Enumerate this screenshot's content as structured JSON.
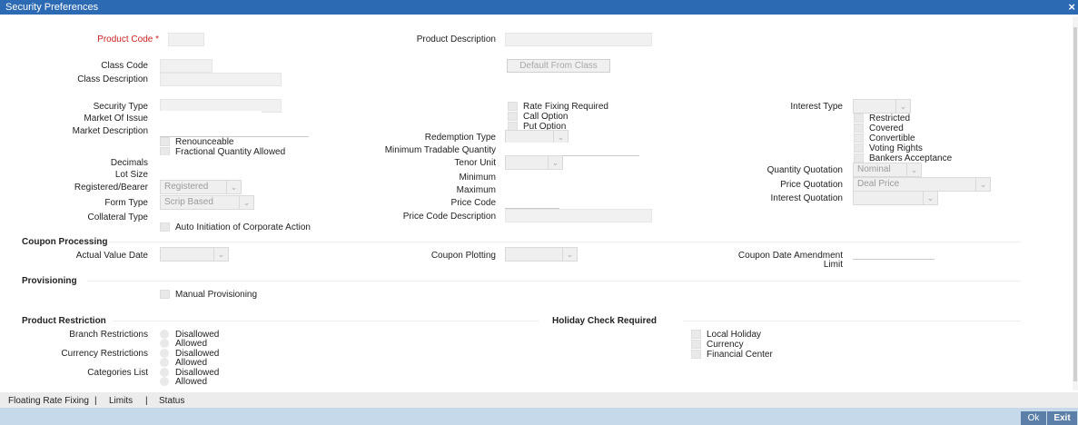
{
  "window": {
    "title": "Security Preferences",
    "close_glyph": "×"
  },
  "fields": {
    "product_code": "Product Code *",
    "product_description": "Product Description",
    "class_code": "Class Code",
    "class_description": "Class Description",
    "default_from_class": "Default From Class",
    "security_type": "Security Type",
    "market_of_issue": "Market Of Issue",
    "market_description": "Market Description",
    "renounceable": "Renounceable",
    "fractional_qty": "Fractional Quantity Allowed",
    "decimals": "Decimals",
    "lot_size": "Lot Size",
    "registered_bearer": "Registered/Bearer",
    "registered_value": "Registered",
    "form_type": "Form Type",
    "form_type_value": "Scrip Based",
    "collateral_type": "Collateral Type",
    "auto_initiation": "Auto Initiation of Corporate Action",
    "rate_fixing": "Rate Fixing Required",
    "call_option": "Call Option",
    "put_option": "Put Option",
    "redemption_type": "Redemption Type",
    "min_tradable_qty": "Minimum Tradable Quantity",
    "tenor_unit": "Tenor Unit",
    "minimum": "Minimum",
    "maximum": "Maximum",
    "price_code": "Price Code",
    "price_code_description": "Price Code Description",
    "interest_type": "Interest Type",
    "restricted": "Restricted",
    "covered": "Covered",
    "convertible": "Convertible",
    "voting_rights": "Voting Rights",
    "bankers_acceptance": "Bankers Acceptance",
    "quantity_quotation": "Quantity Quotation",
    "quantity_quotation_value": "Nominal",
    "price_quotation": "Price Quotation",
    "price_quotation_value": "Deal Price",
    "interest_quotation": "Interest Quotation"
  },
  "coupon": {
    "heading": "Coupon Processing",
    "actual_value_date": "Actual Value Date",
    "coupon_plotting": "Coupon Plotting",
    "amendment_line1": "Coupon Date Amendment",
    "amendment_line2": "Limit"
  },
  "provisioning": {
    "heading": "Provisioning",
    "manual": "Manual Provisioning"
  },
  "restriction": {
    "heading": "Product Restriction",
    "branch": "Branch Restrictions",
    "currency": "Currency Restrictions",
    "categories": "Categories List",
    "disallowed": "Disallowed",
    "allowed": "Allowed"
  },
  "holiday": {
    "heading": "Holiday Check Required",
    "local": "Local Holiday",
    "currency": "Currency",
    "financial_center": "Financial Center"
  },
  "footer": {
    "links": [
      "Floating Rate Fixing",
      "Limits",
      "Status"
    ],
    "separator": "|",
    "ok": "Ok",
    "exit": "Exit"
  }
}
